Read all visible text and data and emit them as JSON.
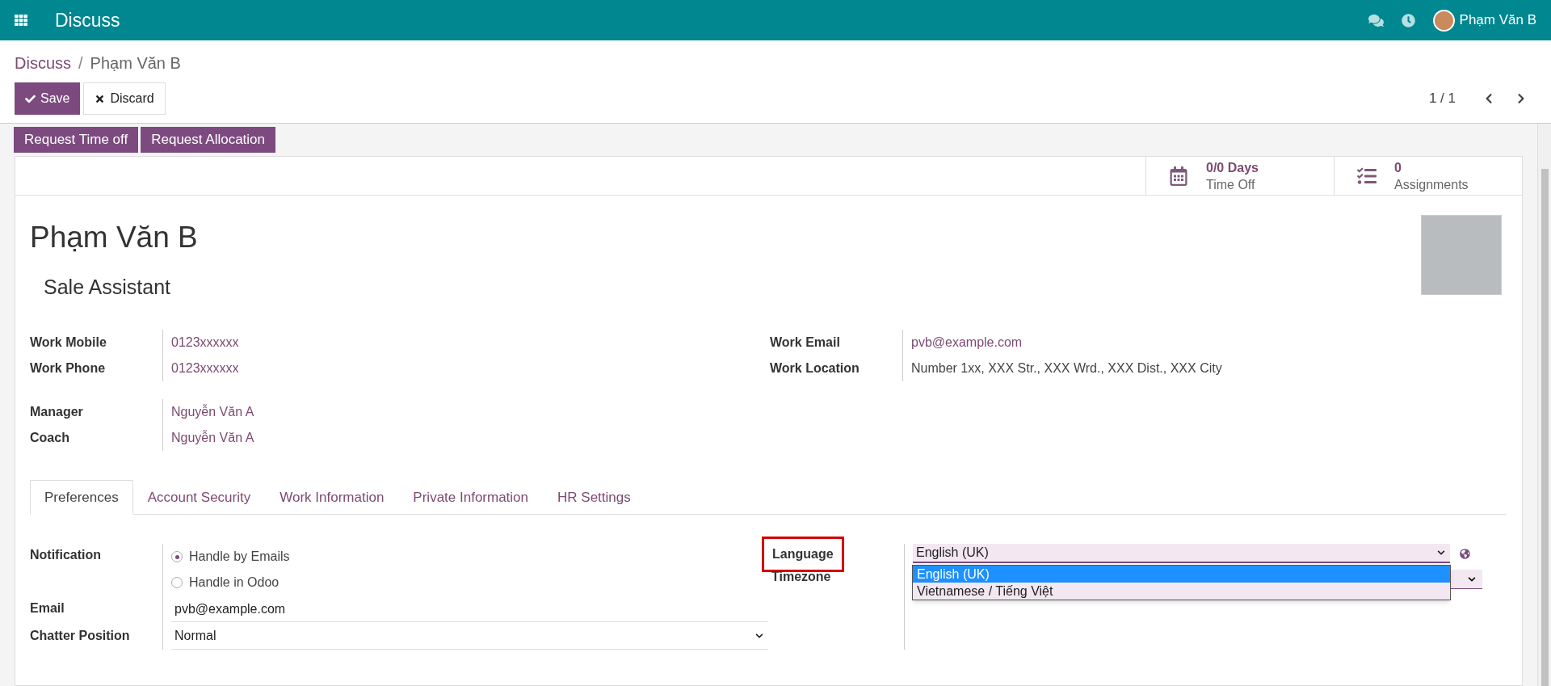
{
  "navbar": {
    "app_title": "Discuss",
    "user_name": "Phạm Văn B"
  },
  "breadcrumb": {
    "items": [
      {
        "label": "Discuss",
        "link": true
      },
      {
        "label": "Phạm Văn B",
        "link": false
      }
    ],
    "separator": "/"
  },
  "control_buttons": [
    {
      "kind": "primary",
      "label": "Save"
    },
    {
      "kind": "secondary",
      "label": "Discard"
    }
  ],
  "pager": "1 / 1",
  "action_buttons": [
    "Request Time off",
    "Request Allocation"
  ],
  "stat_buttons": [
    {
      "kind": "calendar",
      "value": "0/0 Days",
      "label": "Time Off"
    },
    {
      "kind": "list",
      "value": "0",
      "label": "Assignments"
    }
  ],
  "employee": {
    "name": "Phạm Văn B",
    "job_title": "Sale Assistant"
  },
  "left_field_groups": [
    [
      {
        "label": "Work Mobile",
        "value": "0123xxxxxx"
      },
      {
        "label": "Work Phone",
        "value": "0123xxxxxx"
      }
    ],
    [
      {
        "label": "Manager",
        "value": "Nguyễn Văn A"
      },
      {
        "label": "Coach",
        "value": "Nguyễn Văn A"
      }
    ]
  ],
  "right_fields": [
    {
      "label": "Work Email",
      "value": "pvb@example.com",
      "kind": "link"
    },
    {
      "label": "Work Location",
      "value": "Number 1xx, XXX Str., XXX Wrd., XXX Dist., XXX City",
      "kind": "text"
    }
  ],
  "tabs": [
    {
      "label": "Preferences",
      "selected": true
    },
    {
      "label": "Account Security",
      "selected": false
    },
    {
      "label": "Work Information",
      "selected": false
    },
    {
      "label": "Private Information",
      "selected": false
    },
    {
      "label": "HR Settings",
      "selected": false
    }
  ],
  "preferences": {
    "notification": {
      "label": "Notification",
      "options": [
        {
          "label": "Handle by Emails",
          "selected": true
        },
        {
          "label": "Handle in Odoo",
          "selected": false
        }
      ]
    },
    "email": {
      "label": "Email",
      "value": "pvb@example.com"
    },
    "chatter_position": {
      "label": "Chatter Position",
      "value": "Normal"
    },
    "language": {
      "label": "Language",
      "highlighted": true,
      "value": "English (UK)",
      "expanded": true,
      "options": [
        {
          "label": "English (UK)",
          "selected": true
        },
        {
          "label": "Vietnamese / Tiếng Việt",
          "selected": false
        }
      ]
    },
    "timezone": {
      "label": "Timezone"
    }
  }
}
